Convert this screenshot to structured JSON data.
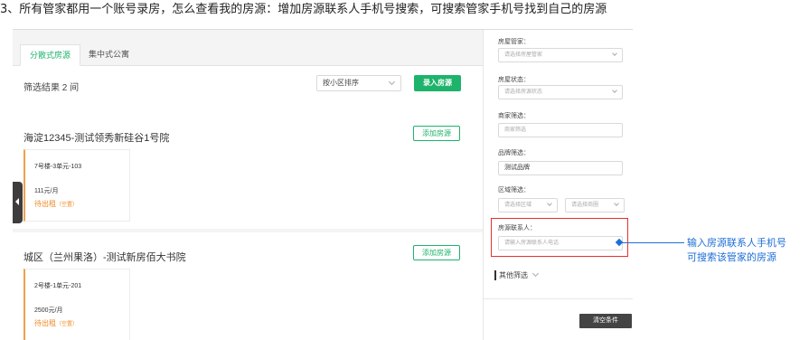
{
  "caption": "3、所有管家都用一个账号录房，怎么查看我的房源：增加房源联系人手机号搜索，可搜索管家手机号找到自己的房源",
  "tabs": [
    {
      "label": "分散式房源",
      "active": true
    },
    {
      "label": "集中式公寓",
      "active": false
    }
  ],
  "toolbar": {
    "result_text": "筛选结果 2 间",
    "sort_value": "按小区排序",
    "add_room_label": "录入房源"
  },
  "communities": [
    {
      "title": "海淀12345-测试领秀新硅谷1号院",
      "add_button": "添加房源",
      "room": {
        "number": "7号楼-3单元-103",
        "price": "111元/月",
        "status": "待出租",
        "status_note": "（空置）"
      }
    },
    {
      "title": "城区（兰州果洛）-测试新房佰大书院",
      "add_button": "添加房源",
      "room": {
        "number": "2号楼-1单元-201",
        "price": "2500元/月",
        "status": "待出租",
        "status_note": "（空置）"
      }
    }
  ],
  "filters": {
    "manager": {
      "label": "房屋管家：",
      "placeholder": "请选择房屋管家"
    },
    "status": {
      "label": "房屋状态：",
      "placeholder": "请选择房源状态"
    },
    "merchant": {
      "label": "商家筛选：",
      "placeholder": "商家筛选"
    },
    "brand": {
      "label": "品牌筛选：",
      "value": "测试品牌"
    },
    "area": {
      "label": "区域筛选：",
      "district_placeholder": "请选择区域",
      "business_placeholder": "请选择商圈"
    },
    "contact": {
      "label": "房源联系人：",
      "placeholder": "请输入房源联系人电话"
    },
    "other_label": "其他筛选",
    "clear_label": "清空条件"
  },
  "annotation": {
    "line1": "输入房源联系人手机号",
    "line2": "可搜索该管家的房源"
  },
  "colors": {
    "accent_green": "#1db36b",
    "status_orange": "#f08a24",
    "highlight_red": "#e53030",
    "annotation_blue": "#1e6fd6"
  }
}
